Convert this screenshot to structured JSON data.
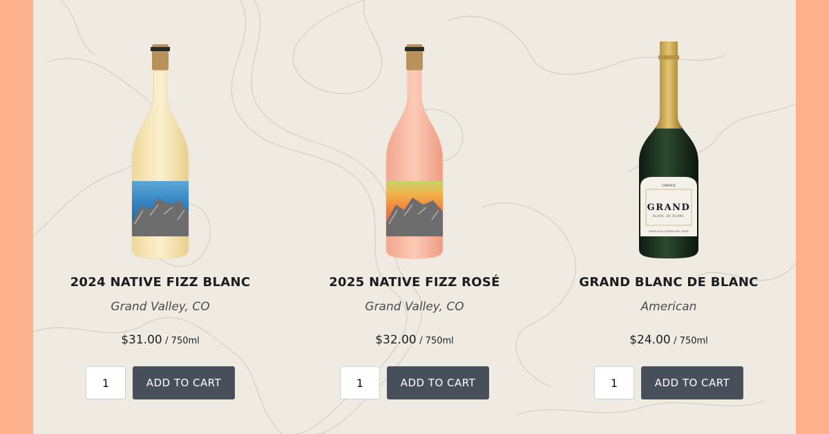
{
  "colors": {
    "frame": "#fdb08c",
    "background": "#efebe3",
    "button": "#47505a",
    "button_text": "#ffffff"
  },
  "products": [
    {
      "name": "2024 NATIVE FIZZ BLANC",
      "region": "Grand Valley, CO",
      "price": "$31.00",
      "separator": "/",
      "volume": "750ml",
      "quantity": "1",
      "cta": "ADD TO CART"
    },
    {
      "name": "2025 NATIVE FIZZ ROSÉ",
      "region": "Grand Valley, CO",
      "price": "$32.00",
      "separator": "/",
      "volume": "750ml",
      "quantity": "1",
      "cta": "ADD TO CART"
    },
    {
      "name": "GRAND BLANC DE BLANC",
      "region": "American",
      "price": "$24.00",
      "separator": "/",
      "volume": "750ml",
      "quantity": "1",
      "cta": "ADD TO CART",
      "label_brand": "CAPROCK",
      "label_title": "GRAND",
      "label_subtitle": "BLANC DE BLANC",
      "label_footer": "AMERICAN SPARKLING WINE"
    }
  ]
}
